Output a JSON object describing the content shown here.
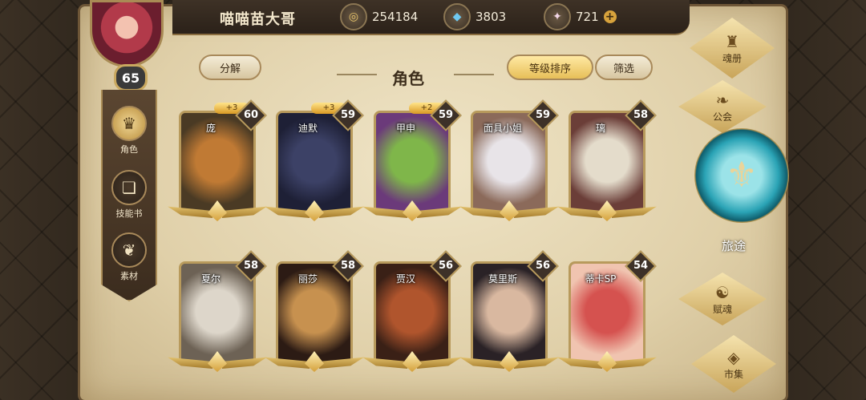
{
  "player": {
    "name": "喵喵苗大哥",
    "level": "65"
  },
  "resources": [
    {
      "icon": "coin-icon",
      "value": "254184"
    },
    {
      "icon": "crystal-icon",
      "value": "3803"
    },
    {
      "icon": "gem-icon",
      "value": "721"
    }
  ],
  "header": {
    "title": "角色",
    "decompose": "分解",
    "sort_by_level": "等级排序",
    "filter": "筛选"
  },
  "left_nav": [
    {
      "label": "角色",
      "icon": "helmet-icon",
      "active": true
    },
    {
      "label": "技能书",
      "icon": "book-icon",
      "active": false
    },
    {
      "label": "素材",
      "icon": "material-icon",
      "active": false
    }
  ],
  "characters": [
    {
      "name": "庞",
      "level": "60",
      "bonus": "+3",
      "colors": [
        "#c07a34",
        "#4a3a24"
      ]
    },
    {
      "name": "迪默",
      "level": "59",
      "bonus": "+3",
      "colors": [
        "#3c4166",
        "#1e2036"
      ]
    },
    {
      "name": "甲申",
      "level": "59",
      "bonus": "+2",
      "colors": [
        "#7fb64a",
        "#6b3a7a"
      ]
    },
    {
      "name": "面具小姐",
      "level": "59",
      "bonus": "",
      "colors": [
        "#e8e4e8",
        "#8b6a5a"
      ]
    },
    {
      "name": "璃",
      "level": "58",
      "bonus": "",
      "colors": [
        "#e4dccb",
        "#6b3e38"
      ]
    },
    {
      "name": "夏尔",
      "level": "58",
      "bonus": "",
      "colors": [
        "#ddd6ca",
        "#6d6255"
      ]
    },
    {
      "name": "丽莎",
      "level": "58",
      "bonus": "",
      "colors": [
        "#c7914f",
        "#2c1b14"
      ]
    },
    {
      "name": "贾汉",
      "level": "56",
      "bonus": "",
      "colors": [
        "#b0552d",
        "#3a2016"
      ]
    },
    {
      "name": "莫里斯",
      "level": "56",
      "bonus": "",
      "colors": [
        "#d9b8a0",
        "#2a2226"
      ]
    },
    {
      "name": "蒂卡SP",
      "level": "54",
      "bonus": "",
      "colors": [
        "#d5524f",
        "#f0c4b0"
      ]
    }
  ],
  "right_menu": {
    "soul_book": "魂册",
    "guild": "公会",
    "journey": "旅途",
    "soul_grant": "赋魂",
    "market": "市集"
  }
}
